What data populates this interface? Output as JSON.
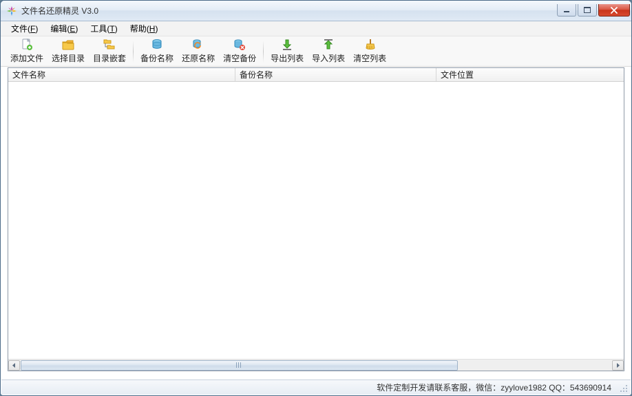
{
  "window": {
    "title": "文件名还原精灵 V3.0"
  },
  "menu": {
    "file": {
      "label": "文件",
      "accel": "F"
    },
    "edit": {
      "label": "编辑",
      "accel": "E"
    },
    "tool": {
      "label": "工具",
      "accel": "T"
    },
    "help": {
      "label": "帮助",
      "accel": "H"
    }
  },
  "toolbar": {
    "addFile": "添加文件",
    "selectDir": "选择目录",
    "dirNest": "目录嵌套",
    "backupName": "备份名称",
    "restoreName": "还原名称",
    "clearBackup": "清空备份",
    "exportList": "导出列表",
    "importList": "导入列表",
    "clearList": "清空列表"
  },
  "columns": {
    "fileName": "文件名称",
    "backupName": "备份名称",
    "filePath": "文件位置"
  },
  "status": {
    "text": "软件定制开发请联系客服，微信：zyylove1982   QQ：543690914"
  }
}
